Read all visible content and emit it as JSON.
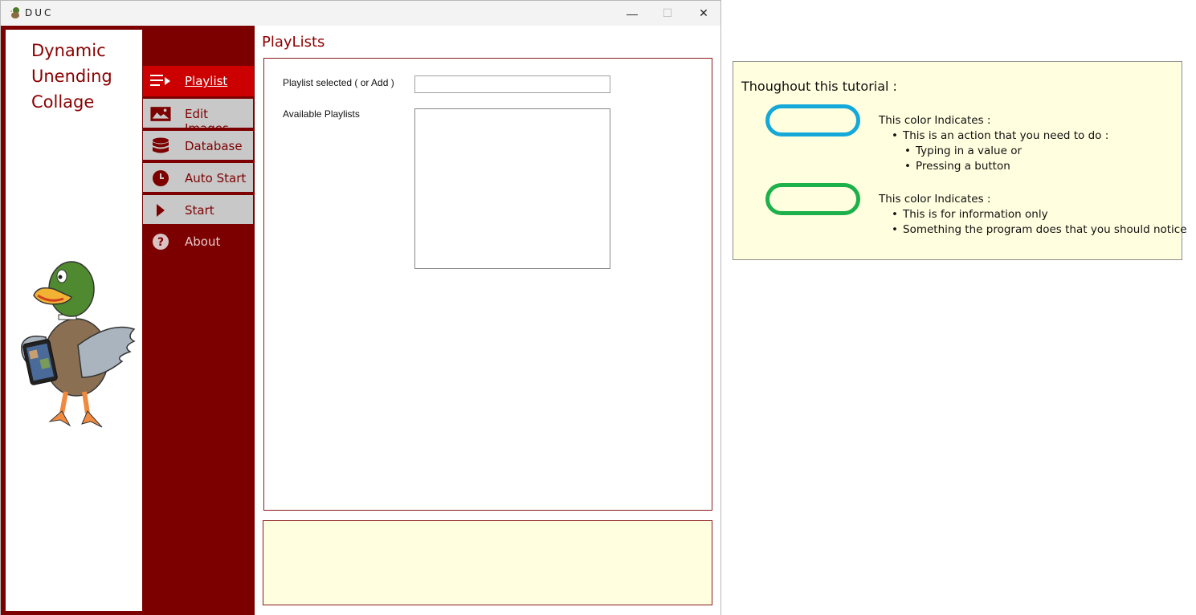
{
  "window": {
    "title": "DUC",
    "minimize_glyph": "—",
    "maximize_glyph": "☐",
    "close_glyph": "✕"
  },
  "brand": {
    "line1": "Dynamic",
    "line2": "Unending",
    "line3": "Collage"
  },
  "nav": {
    "items": [
      {
        "label": "Playlist",
        "icon": "playlist-icon"
      },
      {
        "label": "Edit Images",
        "icon": "image-icon"
      },
      {
        "label": "Database",
        "icon": "database-icon"
      },
      {
        "label": "Auto Start",
        "icon": "clock-icon"
      },
      {
        "label": "Start",
        "icon": "play-icon"
      },
      {
        "label": "About",
        "icon": "help-icon"
      }
    ]
  },
  "playlists": {
    "title": "PlayLists",
    "selected_label": "Playlist selected ( or Add )",
    "selected_value": "",
    "available_label": "Available Playlists"
  },
  "legend": {
    "title": "Thoughout this tutorial :",
    "blue": {
      "heading": "This color Indicates :",
      "point": "This is an action that you need to do :",
      "sub1": "Typing in a value or",
      "sub2": "Pressing a button"
    },
    "green": {
      "heading": "This color Indicates :",
      "point1": "This is for information only",
      "point2": "Something the program does that you should notice"
    }
  },
  "colors": {
    "brand_dark_red": "#7d0000",
    "active_red": "#cc0000",
    "action_blue": "#14a9d8",
    "info_green": "#1db14b",
    "note_yellow": "#fffedf"
  }
}
